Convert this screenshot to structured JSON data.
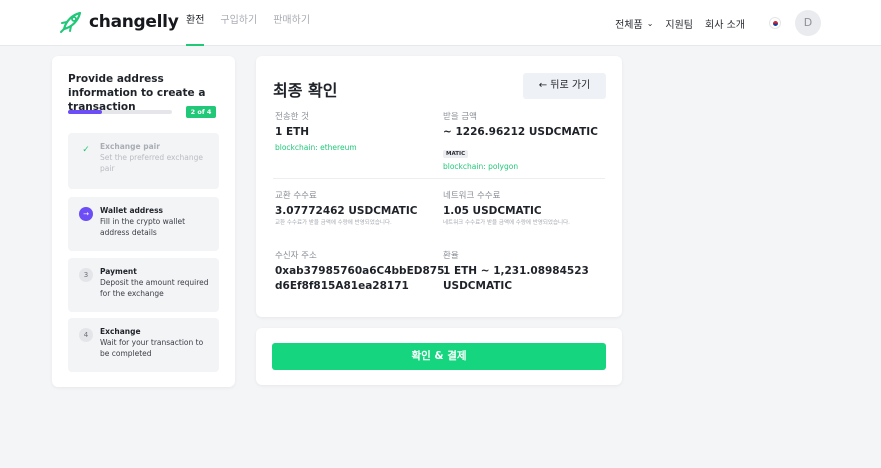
{
  "header": {
    "brand": "changelly",
    "nav": [
      "환전",
      "구입하기",
      "판매하기"
    ],
    "right_nav": {
      "products": "전체품",
      "support": "지원팀",
      "about": "회사 소개"
    },
    "avatar_initial": "D",
    "accent_color": "#21c878"
  },
  "sidebar": {
    "title": "Provide address information to create a transaction",
    "progress": 0.33,
    "step_badge": "2 of 4",
    "steps": [
      {
        "num": "✓",
        "title": "Exchange pair",
        "desc": "Set the preferred exchange pair",
        "state": "done"
      },
      {
        "num": "→",
        "title": "Wallet address",
        "desc": "Fill in the crypto wallet address details",
        "state": "active"
      },
      {
        "num": "3",
        "title": "Payment",
        "desc": "Deposit the amount required for the exchange",
        "state": "pending"
      },
      {
        "num": "4",
        "title": "Exchange",
        "desc": "Wait for your transaction to be completed",
        "state": "pending"
      }
    ]
  },
  "main": {
    "title": "최종 확인",
    "back_button": "←  뒤로 가기",
    "send": {
      "label": "전송한 것",
      "value": "1 ETH",
      "chain": "blockchain: ethereum"
    },
    "receive": {
      "label": "받을 금액",
      "value": "~ 1226.96212 USDCMATIC",
      "tag": "MATIC",
      "chain": "blockchain: polygon"
    },
    "exchange_fee": {
      "label": "교환 수수료",
      "value": "3.07772462 USDCMATIC",
      "note": "교환 수수료가 받을 금액에 수량에 반영되었습니다."
    },
    "network_fee": {
      "label": "네트워크 수수료",
      "value": "1.05 USDCMATIC",
      "note": "네트워크 수수료가 받을 금액에 수량에 반영되었습니다."
    },
    "recipient": {
      "label": "수신자 주소",
      "line1": "0xab37985760a6C4bbED875",
      "line2": "d6Ef8f815A81ea28171"
    },
    "rate": {
      "label": "환율",
      "line1": "1 ETH ~ 1,231.08984523",
      "line2": "USDCMATIC"
    }
  },
  "confirm": {
    "button": "확인 & 결제"
  }
}
